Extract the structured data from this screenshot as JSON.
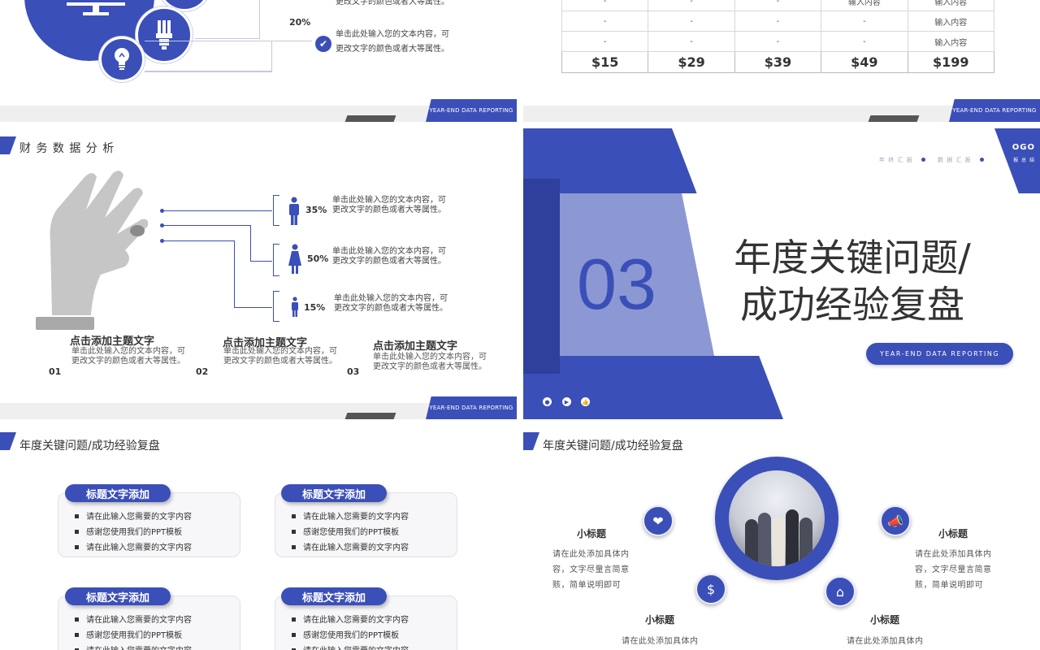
{
  "footer_label": "YEAR-END DATA REPORTING",
  "slide1": {
    "percent": "20%",
    "items": [
      "更改文字的颜色或者大等属性。",
      "单击此处输入您的文本内容，可",
      "更改文字的颜色或者大等属性。"
    ]
  },
  "slide2": {
    "rows": [
      [
        "-",
        "-",
        "-",
        "输入内容",
        "输入内容"
      ],
      [
        "-",
        "-",
        "-",
        "-",
        "输入内容"
      ],
      [
        "-",
        "-",
        "-",
        "-",
        "输入内容"
      ]
    ],
    "prices": [
      "$15",
      "$29",
      "$39",
      "$49",
      "$199"
    ]
  },
  "slide3": {
    "title": "财 务 数 据 分 析",
    "stats": [
      {
        "pct": "35%",
        "line1": "单击此处输入您的文本内容，可",
        "line2": "更改文字的颜色或者大等属性。"
      },
      {
        "pct": "50%",
        "line1": "单击此处输入您的文本内容，可",
        "line2": "更改文字的颜色或者大等属性。"
      },
      {
        "pct": "15%",
        "line1": "单击此处输入您的文本内容，可",
        "line2": "更改文字的颜色或者大等属性。"
      }
    ],
    "footer_items": [
      {
        "num": "01",
        "title": "点击添加主题文字",
        "body": "单击此处输入您的文本内容，可更改文字的颜色或者大等属性。"
      },
      {
        "num": "02",
        "title": "点击添加主题文字",
        "body": "单击此处输入您的文本内容，可更改文字的颜色或者大等属性。"
      },
      {
        "num": "03",
        "title": "点击添加主题文字",
        "body": "单击此处输入您的文本内容，可更改文字的颜色或者大等属性。"
      }
    ]
  },
  "slide4": {
    "number": "03",
    "title_line1": "年度关键问题/",
    "title_line2": "成功经验复盘",
    "pill": "YEAR-END DATA REPORTING",
    "nav1": "年 终 汇 报",
    "nav2": "数 据 汇 报",
    "logo": "OGO",
    "logo_sub": "报 总 结"
  },
  "slide5": {
    "title": "年度关键问题/成功经验复盘",
    "cards": [
      {
        "head": "标题文字添加",
        "items": [
          "请在此输入您需要的文字内容",
          "感谢您使用我们的PPT模板",
          "请在此输入您需要的文字内容"
        ]
      },
      {
        "head": "标题文字添加",
        "items": [
          "请在此输入您需要的文字内容",
          "感谢您使用我们的PPT模板",
          "请在此输入您需要的文字内容"
        ]
      },
      {
        "head": "标题文字添加",
        "items": [
          "请在此输入您需要的文字内容",
          "感谢您使用我们的PPT模板",
          "请在此输入您需要的文字内容"
        ]
      },
      {
        "head": "标题文字添加",
        "items": [
          "请在此输入您需要的文字内容",
          "感谢您使用我们的PPT模板",
          "请在此输入您需要的文字内容"
        ]
      }
    ]
  },
  "slide6": {
    "title": "年度关键问题/成功经验复盘",
    "blocks": [
      {
        "title": "小标题",
        "body": "请在此处添加具体内容，文字尽量言简意赅，简单说明即可"
      },
      {
        "title": "小标题",
        "body": "请在此处添加具体内容，文字尽量言简意赅，简单说明即可"
      },
      {
        "title": "小标题",
        "body": "请在此处添加具体内"
      },
      {
        "title": "小标题",
        "body": "请在此处添加具体内"
      }
    ]
  },
  "colors": {
    "accent": "#3b4fb8",
    "accent_light": "#8b98d4",
    "footer_bg": "#efeff0"
  }
}
